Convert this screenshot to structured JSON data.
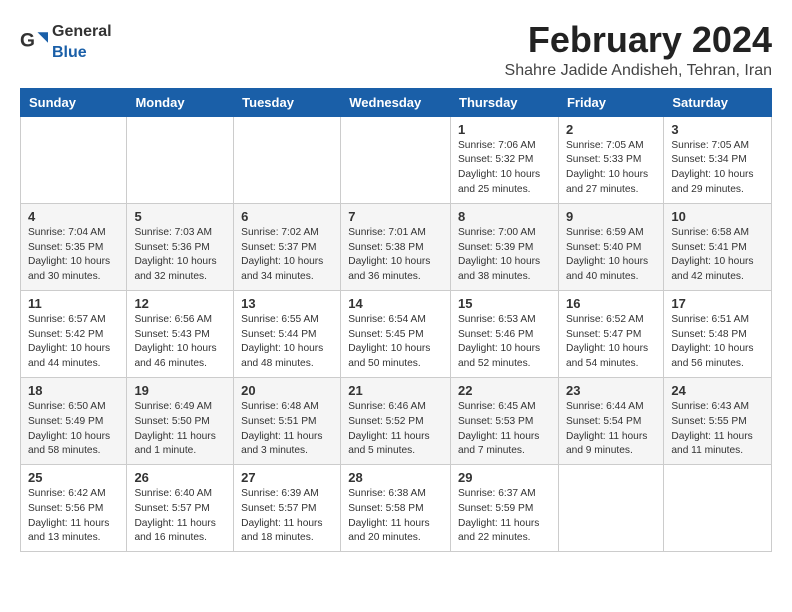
{
  "logo": {
    "text_general": "General",
    "text_blue": "Blue"
  },
  "title": {
    "month_year": "February 2024",
    "location": "Shahre Jadide Andisheh, Tehran, Iran"
  },
  "weekdays": [
    "Sunday",
    "Monday",
    "Tuesday",
    "Wednesday",
    "Thursday",
    "Friday",
    "Saturday"
  ],
  "weeks": [
    [
      {
        "day": "",
        "info": ""
      },
      {
        "day": "",
        "info": ""
      },
      {
        "day": "",
        "info": ""
      },
      {
        "day": "",
        "info": ""
      },
      {
        "day": "1",
        "info": "Sunrise: 7:06 AM\nSunset: 5:32 PM\nDaylight: 10 hours\nand 25 minutes."
      },
      {
        "day": "2",
        "info": "Sunrise: 7:05 AM\nSunset: 5:33 PM\nDaylight: 10 hours\nand 27 minutes."
      },
      {
        "day": "3",
        "info": "Sunrise: 7:05 AM\nSunset: 5:34 PM\nDaylight: 10 hours\nand 29 minutes."
      }
    ],
    [
      {
        "day": "4",
        "info": "Sunrise: 7:04 AM\nSunset: 5:35 PM\nDaylight: 10 hours\nand 30 minutes."
      },
      {
        "day": "5",
        "info": "Sunrise: 7:03 AM\nSunset: 5:36 PM\nDaylight: 10 hours\nand 32 minutes."
      },
      {
        "day": "6",
        "info": "Sunrise: 7:02 AM\nSunset: 5:37 PM\nDaylight: 10 hours\nand 34 minutes."
      },
      {
        "day": "7",
        "info": "Sunrise: 7:01 AM\nSunset: 5:38 PM\nDaylight: 10 hours\nand 36 minutes."
      },
      {
        "day": "8",
        "info": "Sunrise: 7:00 AM\nSunset: 5:39 PM\nDaylight: 10 hours\nand 38 minutes."
      },
      {
        "day": "9",
        "info": "Sunrise: 6:59 AM\nSunset: 5:40 PM\nDaylight: 10 hours\nand 40 minutes."
      },
      {
        "day": "10",
        "info": "Sunrise: 6:58 AM\nSunset: 5:41 PM\nDaylight: 10 hours\nand 42 minutes."
      }
    ],
    [
      {
        "day": "11",
        "info": "Sunrise: 6:57 AM\nSunset: 5:42 PM\nDaylight: 10 hours\nand 44 minutes."
      },
      {
        "day": "12",
        "info": "Sunrise: 6:56 AM\nSunset: 5:43 PM\nDaylight: 10 hours\nand 46 minutes."
      },
      {
        "day": "13",
        "info": "Sunrise: 6:55 AM\nSunset: 5:44 PM\nDaylight: 10 hours\nand 48 minutes."
      },
      {
        "day": "14",
        "info": "Sunrise: 6:54 AM\nSunset: 5:45 PM\nDaylight: 10 hours\nand 50 minutes."
      },
      {
        "day": "15",
        "info": "Sunrise: 6:53 AM\nSunset: 5:46 PM\nDaylight: 10 hours\nand 52 minutes."
      },
      {
        "day": "16",
        "info": "Sunrise: 6:52 AM\nSunset: 5:47 PM\nDaylight: 10 hours\nand 54 minutes."
      },
      {
        "day": "17",
        "info": "Sunrise: 6:51 AM\nSunset: 5:48 PM\nDaylight: 10 hours\nand 56 minutes."
      }
    ],
    [
      {
        "day": "18",
        "info": "Sunrise: 6:50 AM\nSunset: 5:49 PM\nDaylight: 10 hours\nand 58 minutes."
      },
      {
        "day": "19",
        "info": "Sunrise: 6:49 AM\nSunset: 5:50 PM\nDaylight: 11 hours\nand 1 minute."
      },
      {
        "day": "20",
        "info": "Sunrise: 6:48 AM\nSunset: 5:51 PM\nDaylight: 11 hours\nand 3 minutes."
      },
      {
        "day": "21",
        "info": "Sunrise: 6:46 AM\nSunset: 5:52 PM\nDaylight: 11 hours\nand 5 minutes."
      },
      {
        "day": "22",
        "info": "Sunrise: 6:45 AM\nSunset: 5:53 PM\nDaylight: 11 hours\nand 7 minutes."
      },
      {
        "day": "23",
        "info": "Sunrise: 6:44 AM\nSunset: 5:54 PM\nDaylight: 11 hours\nand 9 minutes."
      },
      {
        "day": "24",
        "info": "Sunrise: 6:43 AM\nSunset: 5:55 PM\nDaylight: 11 hours\nand 11 minutes."
      }
    ],
    [
      {
        "day": "25",
        "info": "Sunrise: 6:42 AM\nSunset: 5:56 PM\nDaylight: 11 hours\nand 13 minutes."
      },
      {
        "day": "26",
        "info": "Sunrise: 6:40 AM\nSunset: 5:57 PM\nDaylight: 11 hours\nand 16 minutes."
      },
      {
        "day": "27",
        "info": "Sunrise: 6:39 AM\nSunset: 5:57 PM\nDaylight: 11 hours\nand 18 minutes."
      },
      {
        "day": "28",
        "info": "Sunrise: 6:38 AM\nSunset: 5:58 PM\nDaylight: 11 hours\nand 20 minutes."
      },
      {
        "day": "29",
        "info": "Sunrise: 6:37 AM\nSunset: 5:59 PM\nDaylight: 11 hours\nand 22 minutes."
      },
      {
        "day": "",
        "info": ""
      },
      {
        "day": "",
        "info": ""
      }
    ]
  ]
}
